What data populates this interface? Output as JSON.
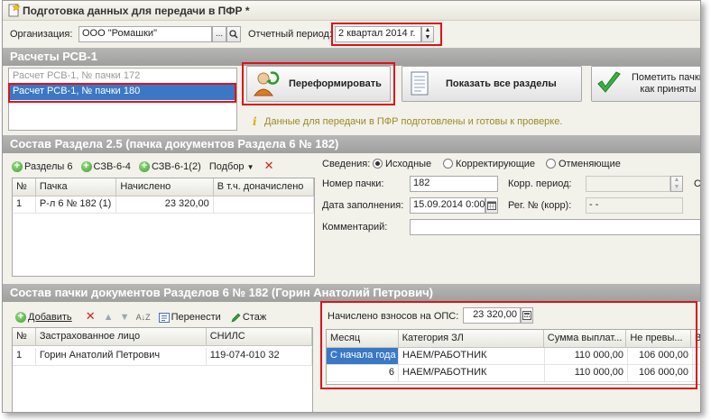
{
  "window": {
    "title": "Подготовка данных для передачи в ПФР *"
  },
  "org": {
    "label": "Организация:",
    "value": "ООО \"Ромашки\"",
    "ellipsis": "...",
    "search_glyph": "🔍"
  },
  "period": {
    "label": "Отчетный период:",
    "value": "2 квартал 2014 г."
  },
  "rsv": {
    "section_title": "Расчеты РСВ-1",
    "items": [
      {
        "label": "Расчет РСВ-1, № пачки 172"
      },
      {
        "label": "Расчет РСВ-1, № пачки 180"
      }
    ],
    "reform_button": "Переформировать",
    "show_sections_button": "Показать все разделы",
    "mark_button_line1": "Пометить пачки",
    "mark_button_line2": "как приняты",
    "info_text": "Данные для передачи в ПФР подготовлены и готовы к проверке."
  },
  "section25": {
    "title": "Состав Раздела 2.5    (пачка документов Раздела 6 № 182)",
    "toolbar": {
      "razdely": "Разделы 6",
      "szv64": "СЗВ-6-4",
      "szv61": "СЗВ-6-1(2)",
      "podbor": "Подбор"
    },
    "columns": [
      "№",
      "Пачка",
      "Начислено",
      "В т.ч. доначислено"
    ],
    "rows": [
      {
        "n": "1",
        "pachka": "Р-л 6 № 182 (1)",
        "nachisleno": "23 320,00",
        "donach": ""
      }
    ],
    "svedeniya": {
      "label": "Сведения:",
      "options": [
        "Исходные",
        "Корректирующие",
        "Отменяющие"
      ],
      "selected": "Исходные"
    },
    "nomer_label": "Номер пачки:",
    "nomer_value": "182",
    "korr_period_label": "Корр. период:",
    "data_label": "Дата заполнения:",
    "data_value": "15.09.2014  0:00",
    "reg_label": "Рег. № (корр):",
    "reg_value": "-   -",
    "comment_label": "Комментарий:",
    "comment_value": "",
    "cut_letter": "С"
  },
  "pack": {
    "title": "Состав пачки документов Разделов 6 № 182        (Горин Анатолий Петрович)",
    "toolbar": {
      "add": "Добавить",
      "move": "Перенести",
      "stazh": "Стаж"
    },
    "columns": [
      "№",
      "Застрахованное лицо",
      "СНИЛС"
    ],
    "rows": [
      {
        "n": "1",
        "name": "Горин Анатолий Петрович",
        "snils": "119-074-010 32"
      }
    ],
    "ops_label": "Начислено взносов на ОПС:",
    "ops_value": "23 320,00",
    "table": {
      "columns": [
        "Месяц",
        "Категория ЗЛ",
        "Сумма выплат...",
        "Не превы...",
        "В"
      ],
      "rows": [
        {
          "month": "С начала года",
          "cat": "НАЕМ/РАБОТНИК",
          "sum": "110 000,00",
          "limit": "106 000,00"
        },
        {
          "month": "6",
          "cat": "НАЕМ/РАБОТНИК",
          "sum": "110 000,00",
          "limit": "106 000,00"
        }
      ]
    }
  },
  "colors": {
    "accent_red": "#e0101c",
    "selection_blue": "#3a78c6",
    "section_gray": "#a8a9a7"
  }
}
